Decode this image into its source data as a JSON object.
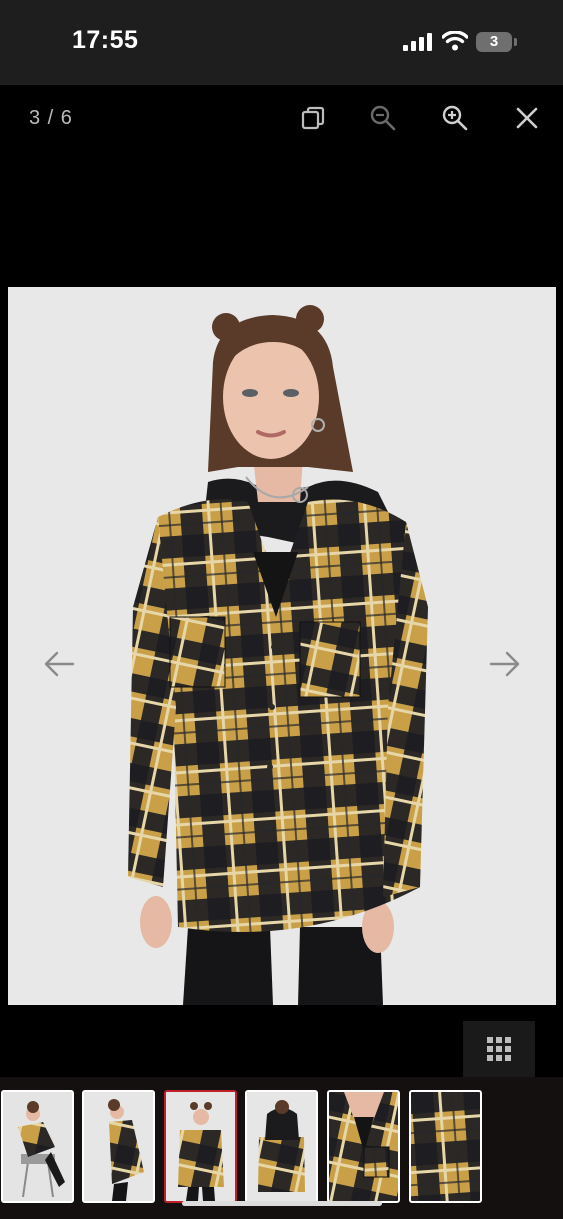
{
  "status_bar": {
    "time": "17:55",
    "battery_level": "3",
    "icons": [
      "cellular-signal-icon",
      "wifi-icon",
      "battery-icon"
    ]
  },
  "viewer": {
    "counter": "3 / 6",
    "tools": [
      "copy-icon",
      "zoom-out-icon",
      "zoom-in-icon",
      "close-icon"
    ],
    "nav": [
      "arrow-left-icon",
      "arrow-right-icon"
    ],
    "grid_icon": "grid-icon"
  },
  "product_image": {
    "colors": {
      "yellow": "#c9a048",
      "black": "#1d1d22",
      "cream": "#e6d6a8",
      "background": "#e8e8e8"
    }
  },
  "thumbnails": {
    "count": 6,
    "active_index": 2,
    "active_color": "#c0202a"
  }
}
